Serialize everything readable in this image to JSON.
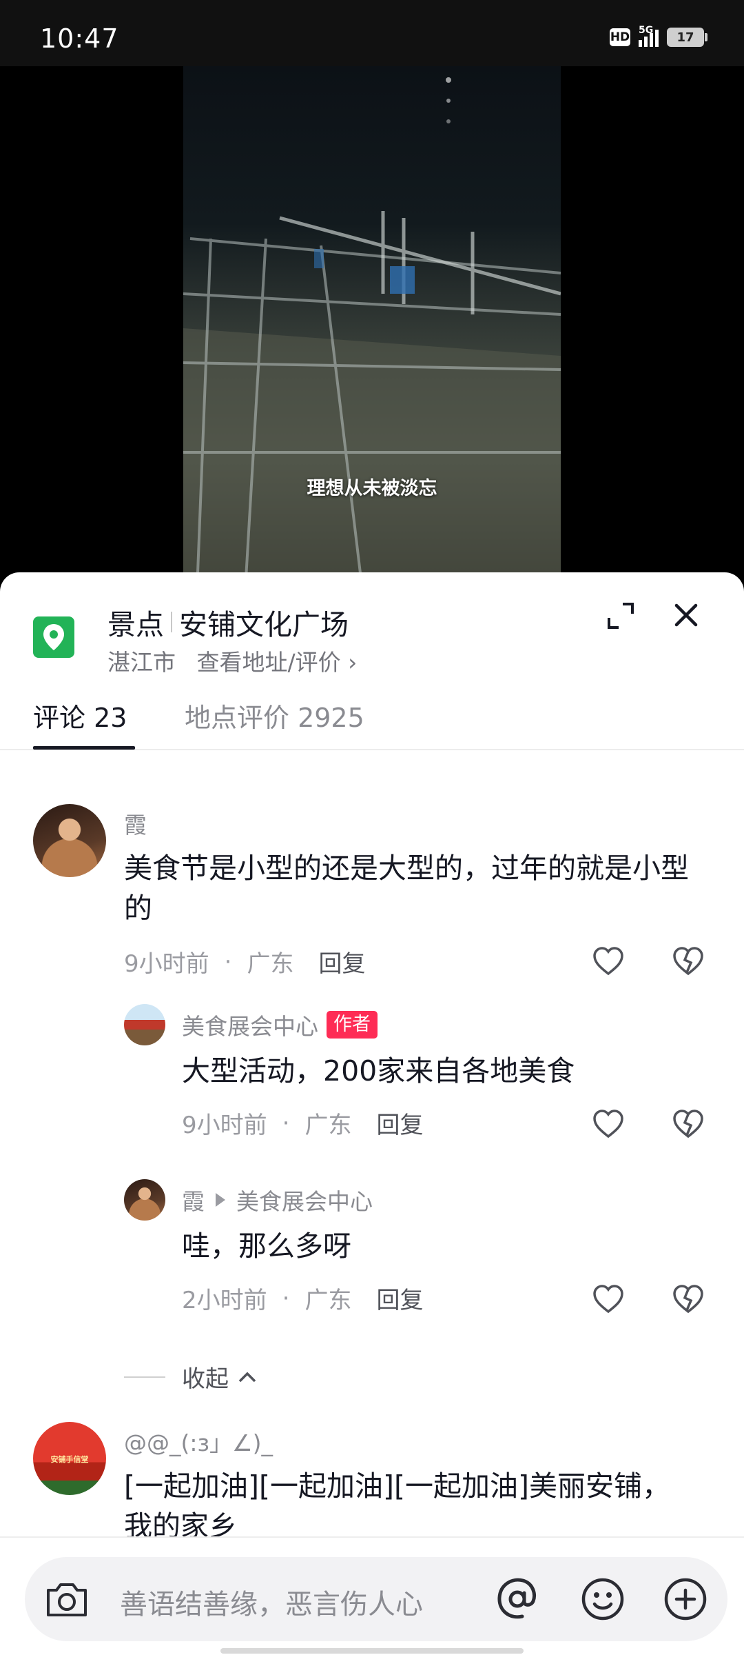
{
  "status_bar": {
    "time": "10:47",
    "hd": "HD",
    "network": "5G",
    "battery": "17"
  },
  "video": {
    "caption": "理想从未被淡忘"
  },
  "poi": {
    "category": "景点",
    "name": "安铺文化广场",
    "city": "湛江市",
    "link": "查看地址/评价",
    "chevron": "›",
    "icon": "location-pin-icon"
  },
  "tabs": [
    {
      "label": "评论 23",
      "active": true
    },
    {
      "label": "地点评价 2925",
      "active": false
    }
  ],
  "comments": [
    {
      "user": "霞",
      "text": "美食节是小型的还是大型的，过年的就是小型的",
      "time": "9小时前",
      "region": "广东",
      "dot": "·",
      "reply_label": "回复",
      "replies": [
        {
          "user": "美食展会中心",
          "badge": "作者",
          "text": "大型活动，200家来自各地美食",
          "time": "9小时前",
          "region": "广东",
          "dot": "·",
          "reply_label": "回复"
        },
        {
          "user": "霞",
          "reply_to": "美食展会中心",
          "text": "哇，那么多呀",
          "time": "2小时前",
          "region": "广东",
          "dot": "·",
          "reply_label": "回复"
        }
      ],
      "collapse_label": "收起"
    },
    {
      "user": "@@_(:з」∠)_",
      "avatar_text": "安铺手信堂",
      "text": "[一起加油][一起加油][一起加油]美丽安铺，我的家乡"
    }
  ],
  "input": {
    "placeholder": "善语结善缘，恶言伤人心"
  },
  "colors": {
    "accent": "#fe2c55",
    "poi_green": "#22b357",
    "text": "#161823",
    "secondary": "#8a8b91"
  }
}
